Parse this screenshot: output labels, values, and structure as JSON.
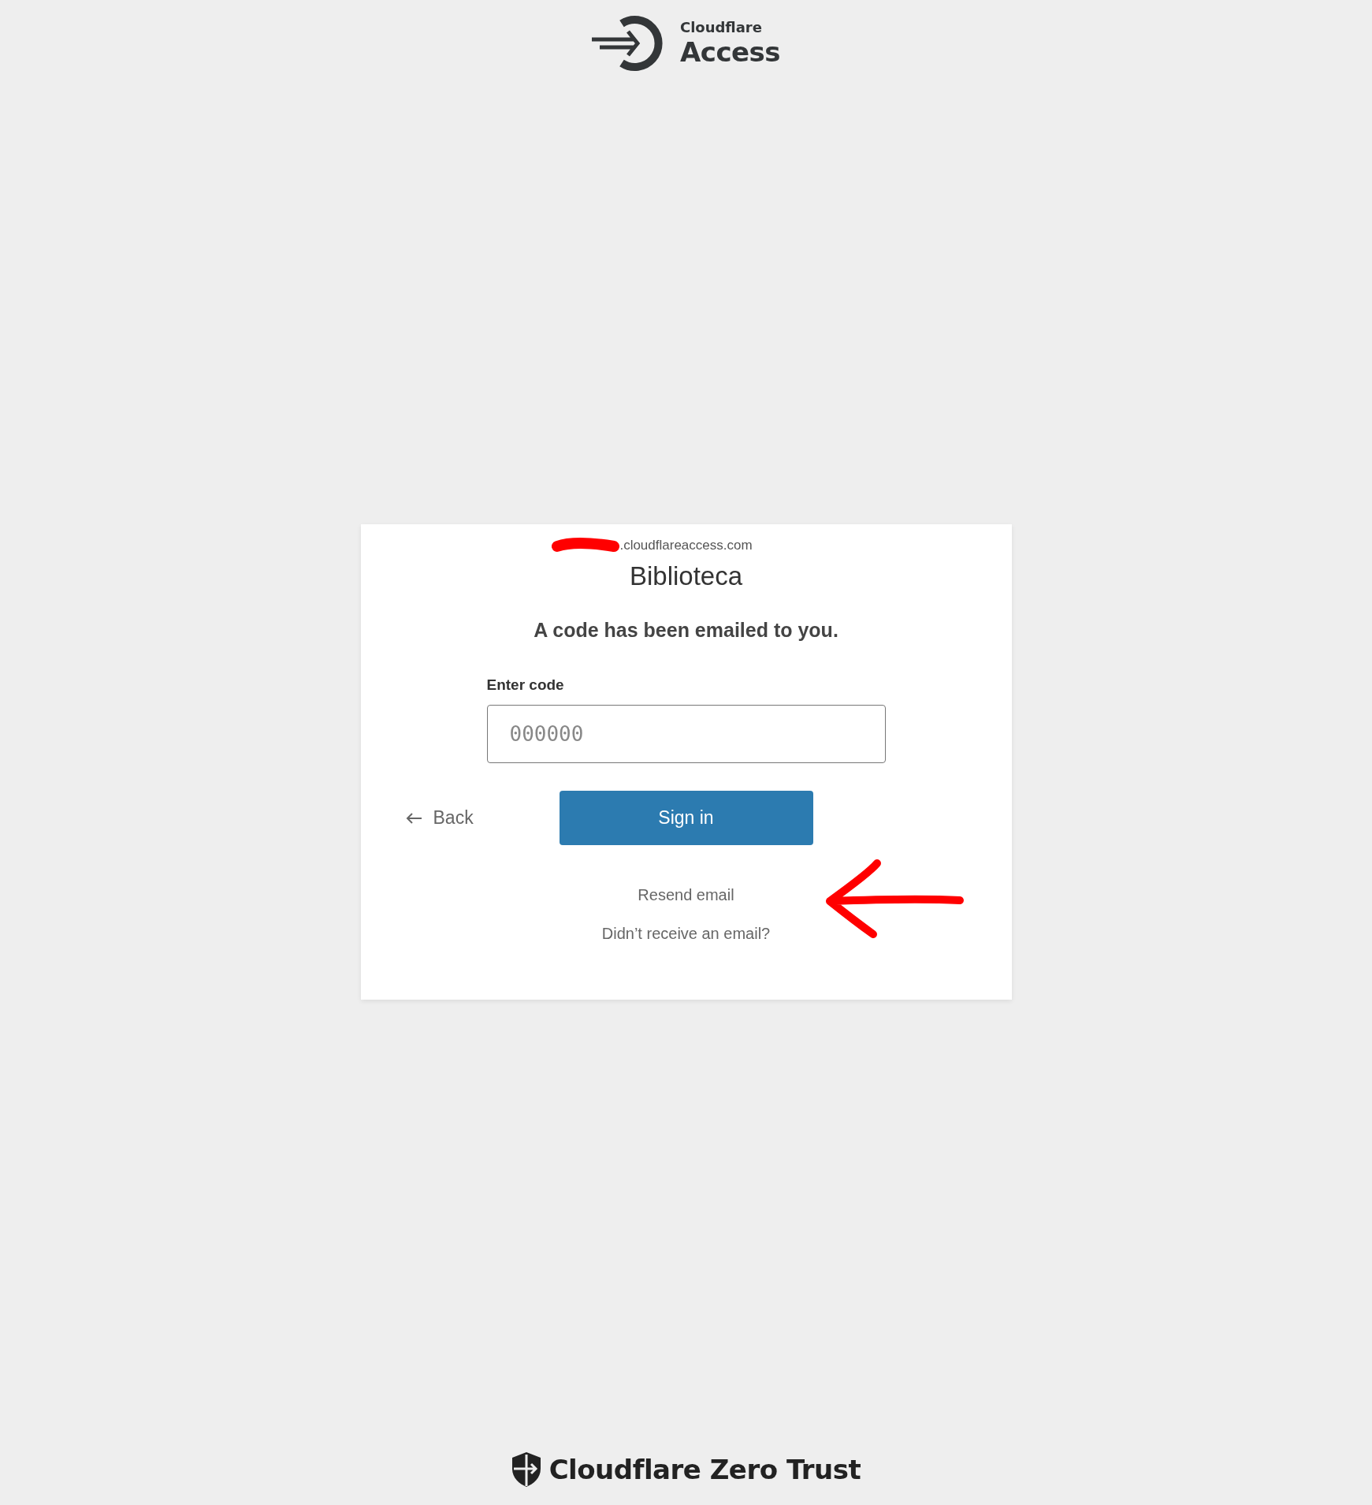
{
  "header": {
    "product": "Cloudflare",
    "title": "Access"
  },
  "card": {
    "domain": ".cloudflareaccess.com",
    "app_name": "Biblioteca",
    "message": "A code has been emailed to you.",
    "field": {
      "label": "Enter code",
      "placeholder": "000000"
    },
    "back": "Back",
    "submit": "Sign in",
    "resend": "Resend email",
    "help": "Didn’t receive an email?"
  },
  "footer": {
    "brand": "Cloudflare Zero Trust"
  }
}
